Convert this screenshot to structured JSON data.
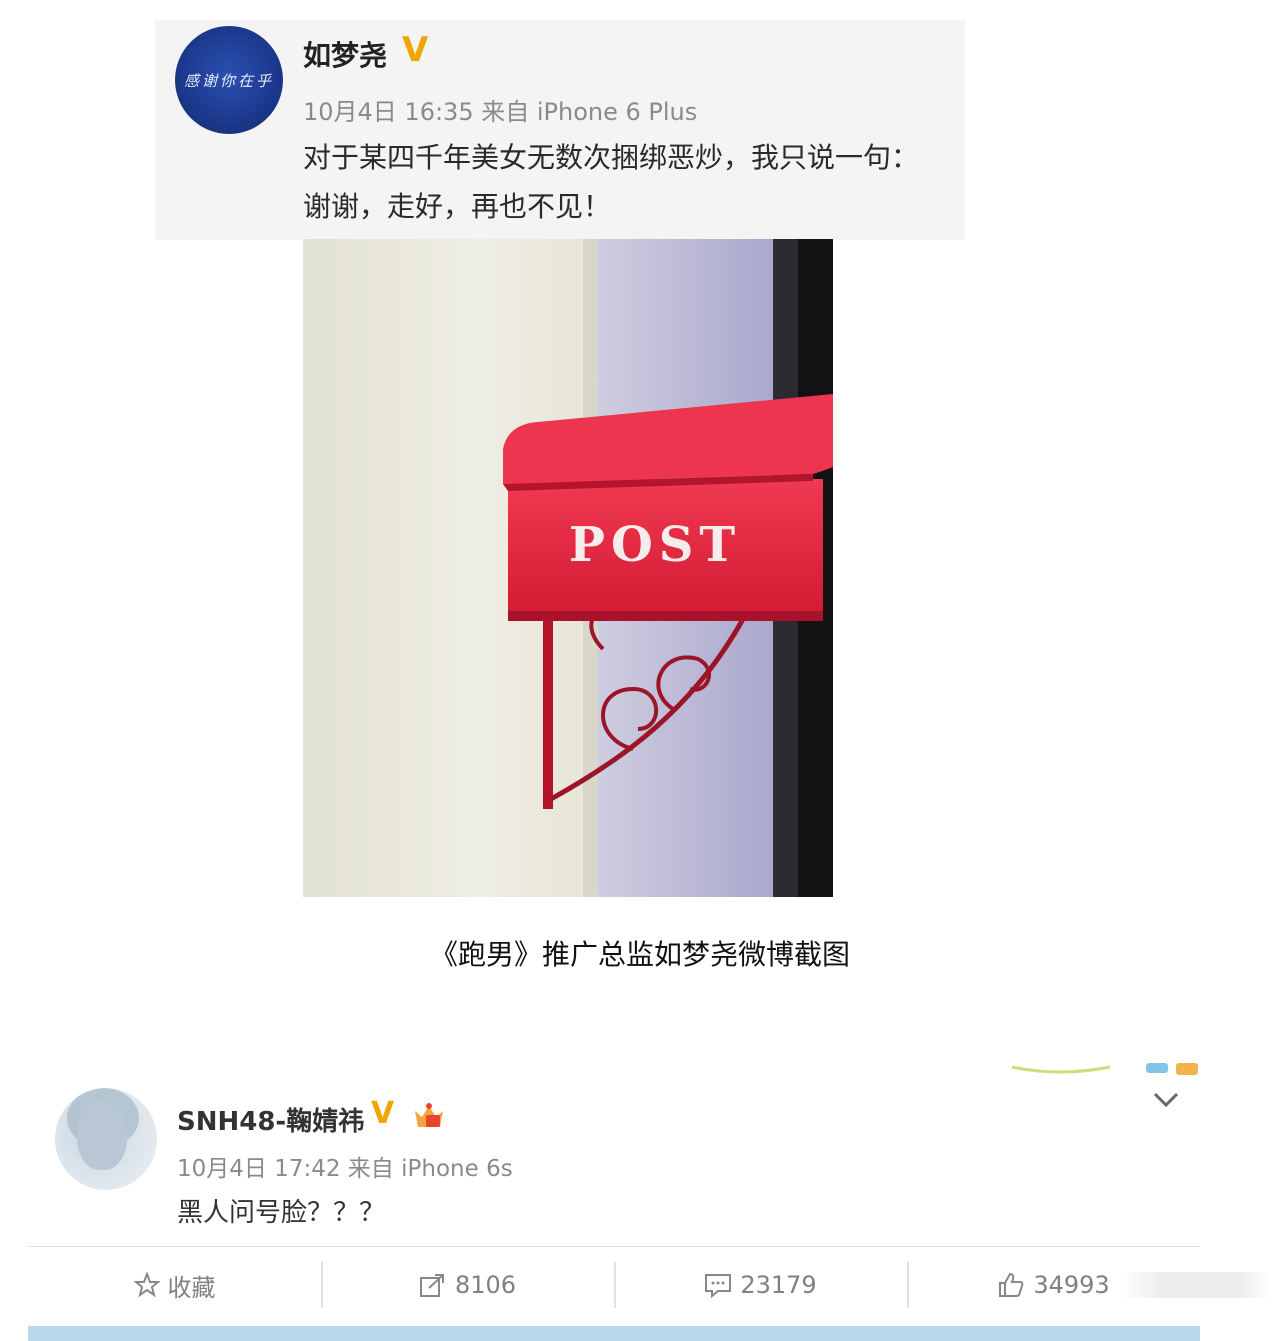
{
  "post1": {
    "avatar_text": "感谢你在乎",
    "name": "如梦尧",
    "verified_badge": "V",
    "meta": "10月4日 16:35 来自 iPhone 6 Plus",
    "text_line1": "对于某四千年美女无数次捆绑恶炒，我只说一句：",
    "text_line2": "谢谢，走好，再也不见！",
    "photo": {
      "sign_text": "POST",
      "colors": {
        "mailbox": "#e8223c",
        "wall": "#ebe9dc",
        "shadow": "#bcb9d6"
      }
    }
  },
  "caption": "《跑男》推广总监如梦尧微博截图",
  "post2": {
    "name": "SNH48-鞠婧祎",
    "verified_badge": "V",
    "meta": "10月4日 17:42 来自 iPhone 6s",
    "text": "黑人问号脸？？？",
    "actions": {
      "favorite_label": "收藏",
      "repost_count": "8106",
      "comment_count": "23179",
      "like_count": "34993"
    }
  },
  "colors": {
    "accent_orange": "#f0a500",
    "bottom_bar": "#b9d9ea"
  }
}
